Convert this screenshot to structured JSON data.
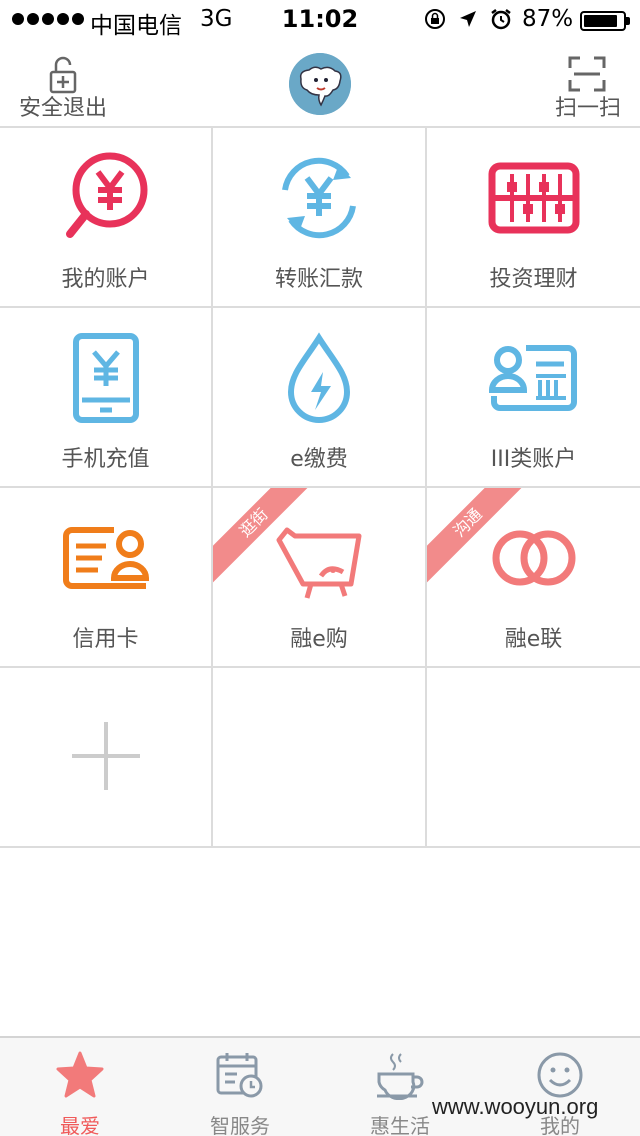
{
  "status_bar": {
    "carrier": "中国电信",
    "network": "3G",
    "time": "11:02",
    "battery_percent_text": "87%",
    "battery_level": 0.87
  },
  "header": {
    "logout_label": "安全退出",
    "scan_label": "扫一扫"
  },
  "grid": {
    "items": [
      {
        "label": "我的账户",
        "icon": "yuan-search-icon",
        "color": "#e8325a"
      },
      {
        "label": "转账汇款",
        "icon": "yuan-transfer-icon",
        "color": "#5fb6e3"
      },
      {
        "label": "投资理财",
        "icon": "abacus-icon",
        "color": "#e8325a"
      },
      {
        "label": "手机充值",
        "icon": "phone-yuan-icon",
        "color": "#5fb6e3"
      },
      {
        "label": "e缴费",
        "icon": "water-drop-bolt-icon",
        "color": "#5fb6e3"
      },
      {
        "label": "III类账户",
        "icon": "account-card-icon",
        "color": "#5fb6e3"
      },
      {
        "label": "信用卡",
        "icon": "credit-card-user-icon",
        "color": "#f07d1a"
      },
      {
        "label": "融e购",
        "icon": "shopping-bag-icon",
        "color": "#f27a7a",
        "ribbon": "逛街"
      },
      {
        "label": "融e联",
        "icon": "chat-rings-icon",
        "color": "#f27a7a",
        "ribbon": "沟通"
      },
      {
        "label": "",
        "icon": "plus-icon",
        "color": "#cccccc"
      }
    ]
  },
  "tab_bar": {
    "tabs": [
      {
        "label": "最爱",
        "icon": "star-icon",
        "active": true
      },
      {
        "label": "智服务",
        "icon": "calendar-clock-icon",
        "active": false
      },
      {
        "label": "惠生活",
        "icon": "coffee-cup-icon",
        "active": false
      },
      {
        "label": "我的",
        "icon": "smiley-icon",
        "active": false
      }
    ],
    "active_color": "#f05a5a",
    "inactive_color": "#888888"
  },
  "watermark": "www.wooyun.org"
}
